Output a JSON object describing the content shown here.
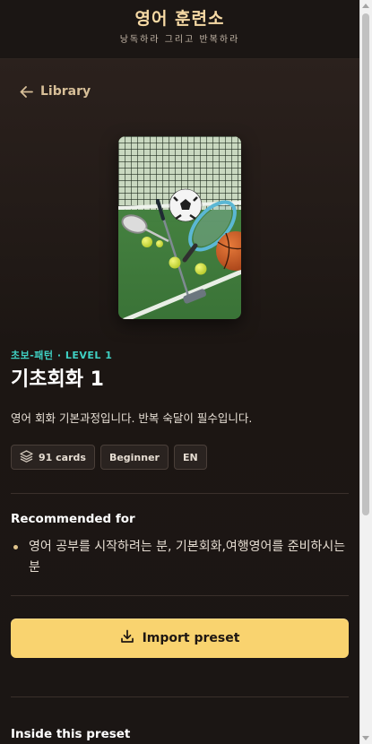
{
  "header": {
    "title": "영어 훈련소",
    "subtitle": "낭독하라 그리고 반복하라"
  },
  "nav": {
    "back_label": "Library"
  },
  "preset": {
    "kicker": "초보-패턴 · LEVEL 1",
    "title": "기초회화 1",
    "description": "영어 회화 기본과정입니다. 반복 숙달이 필수입니다.",
    "badges": {
      "cards": "91 cards",
      "level": "Beginner",
      "language": "EN"
    }
  },
  "recommended": {
    "heading": "Recommended for",
    "items": [
      "영어 공부를 시작하려는 분, 기본회화,여행영어를 준비하시는 분"
    ]
  },
  "actions": {
    "import_label": "Import preset"
  },
  "inside": {
    "heading": "Inside this preset"
  },
  "colors": {
    "accent": "#f9d36f",
    "kicker": "#3fd0c3",
    "title": "#f6d9a4"
  }
}
